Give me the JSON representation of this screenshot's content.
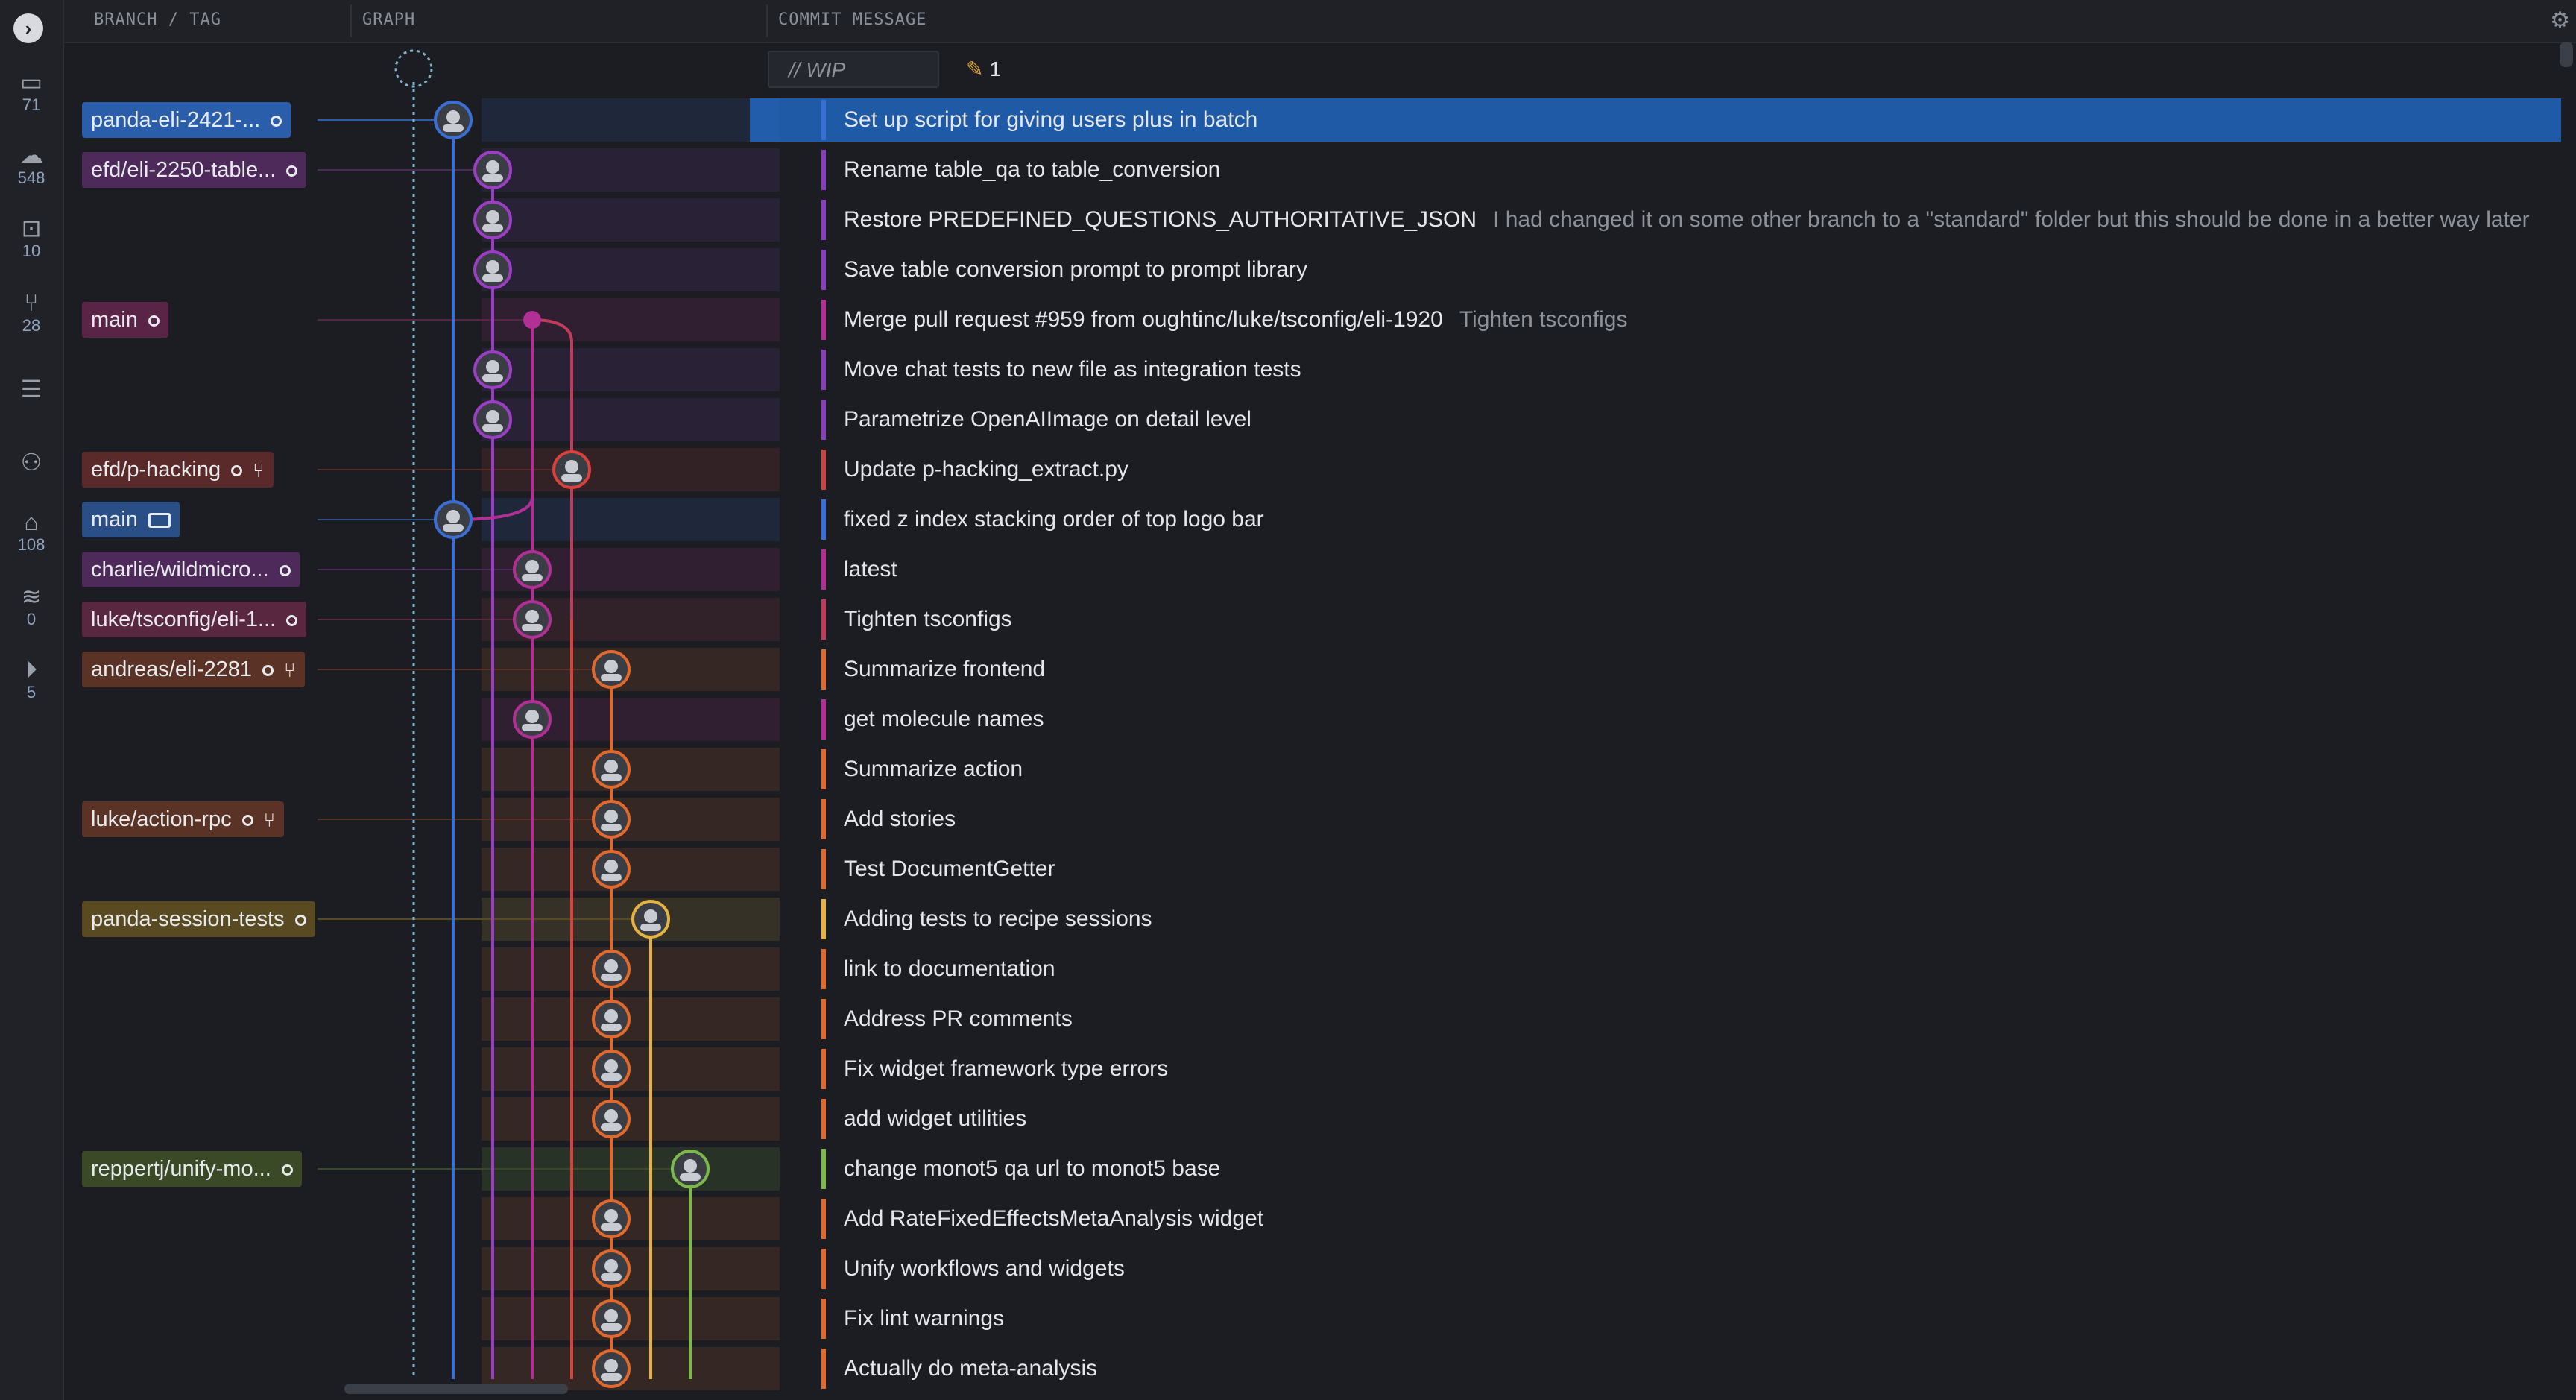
{
  "colors": {
    "accent": "#1f5aa6",
    "background": "#1b1d22"
  },
  "header": {
    "col_branch": "BRANCH / TAG",
    "col_graph": "GRAPH",
    "col_message": "COMMIT MESSAGE"
  },
  "rail": {
    "items": [
      {
        "icon": "laptop-icon",
        "count": "71"
      },
      {
        "icon": "cloud-icon",
        "count": "548"
      },
      {
        "icon": "inbox-icon",
        "count": "10"
      },
      {
        "icon": "pull-request-icon",
        "count": "28"
      },
      {
        "icon": "list-icon",
        "count": ""
      },
      {
        "icon": "team-icon",
        "count": ""
      },
      {
        "icon": "tag-icon",
        "count": "108"
      },
      {
        "icon": "stash-icon",
        "count": "0"
      },
      {
        "icon": "play-icon",
        "count": "5"
      }
    ]
  },
  "wip": {
    "placeholder": "// WIP",
    "count": "1"
  },
  "commits": [
    {
      "message": "Set up script for giving users plus in batch",
      "desc": "",
      "branch": "panda-eli-2421-..."
    },
    {
      "message": "Rename table_qa to table_conversion",
      "desc": "",
      "branch": "efd/eli-2250-table..."
    },
    {
      "message": "Restore PREDEFINED_QUESTIONS_AUTHORITATIVE_JSON",
      "desc": "I had changed it on some other branch to a \"standard\" folder but this should be done in a better way later",
      "branch": ""
    },
    {
      "message": "Save table conversion prompt to prompt library",
      "desc": "",
      "branch": ""
    },
    {
      "message": "Merge pull request #959 from oughtinc/luke/tsconfig/eli-1920",
      "desc": "Tighten tsconfigs",
      "branch": "main"
    },
    {
      "message": "Move chat tests to new file as integration tests",
      "desc": "",
      "branch": ""
    },
    {
      "message": "Parametrize OpenAIImage on detail level",
      "desc": "",
      "branch": ""
    },
    {
      "message": "Update p-hacking_extract.py",
      "desc": "",
      "branch": "efd/p-hacking"
    },
    {
      "message": "fixed z index stacking order of top logo bar",
      "desc": "",
      "branch": "main"
    },
    {
      "message": "latest",
      "desc": "",
      "branch": "charlie/wildmicro..."
    },
    {
      "message": "Tighten tsconfigs",
      "desc": "",
      "branch": "luke/tsconfig/eli-1..."
    },
    {
      "message": "Summarize frontend",
      "desc": "",
      "branch": "andreas/eli-2281"
    },
    {
      "message": "get molecule names",
      "desc": "",
      "branch": ""
    },
    {
      "message": "Summarize action",
      "desc": "",
      "branch": ""
    },
    {
      "message": "Add stories",
      "desc": "",
      "branch": "luke/action-rpc"
    },
    {
      "message": "Test DocumentGetter",
      "desc": "",
      "branch": ""
    },
    {
      "message": "Adding tests to recipe sessions",
      "desc": "",
      "branch": "panda-session-tests"
    },
    {
      "message": "link to documentation",
      "desc": "",
      "branch": ""
    },
    {
      "message": "Address PR comments",
      "desc": "",
      "branch": ""
    },
    {
      "message": "Fix widget framework type errors",
      "desc": "",
      "branch": ""
    },
    {
      "message": "add widget utilities",
      "desc": "",
      "branch": ""
    },
    {
      "message": "change monot5 qa url to monot5 base",
      "desc": "",
      "branch": "reppertj/unify-mo..."
    },
    {
      "message": "Add RateFixedEffectsMetaAnalysis widget",
      "desc": "",
      "branch": ""
    },
    {
      "message": "Unify workflows and widgets",
      "desc": "",
      "branch": ""
    },
    {
      "message": "Fix lint warnings",
      "desc": "",
      "branch": ""
    },
    {
      "message": "Actually do meta-analysis",
      "desc": "",
      "branch": ""
    }
  ]
}
